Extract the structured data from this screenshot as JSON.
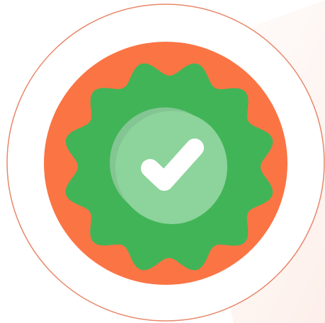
{
  "badge": {
    "icon": "verified-badge-icon",
    "check_icon": "checkmark-icon",
    "colors": {
      "background": "#ffffff",
      "background_shade": "#fbe3da",
      "outer_ring_fill": "#ffffff",
      "outer_ring_stroke": "#e8876a",
      "orange_disc": "#fb7444",
      "seal": "#42b458",
      "inner_shadow": "#84c693",
      "inner_circle": "#8cd49b",
      "checkmark": "#ffffff"
    }
  }
}
